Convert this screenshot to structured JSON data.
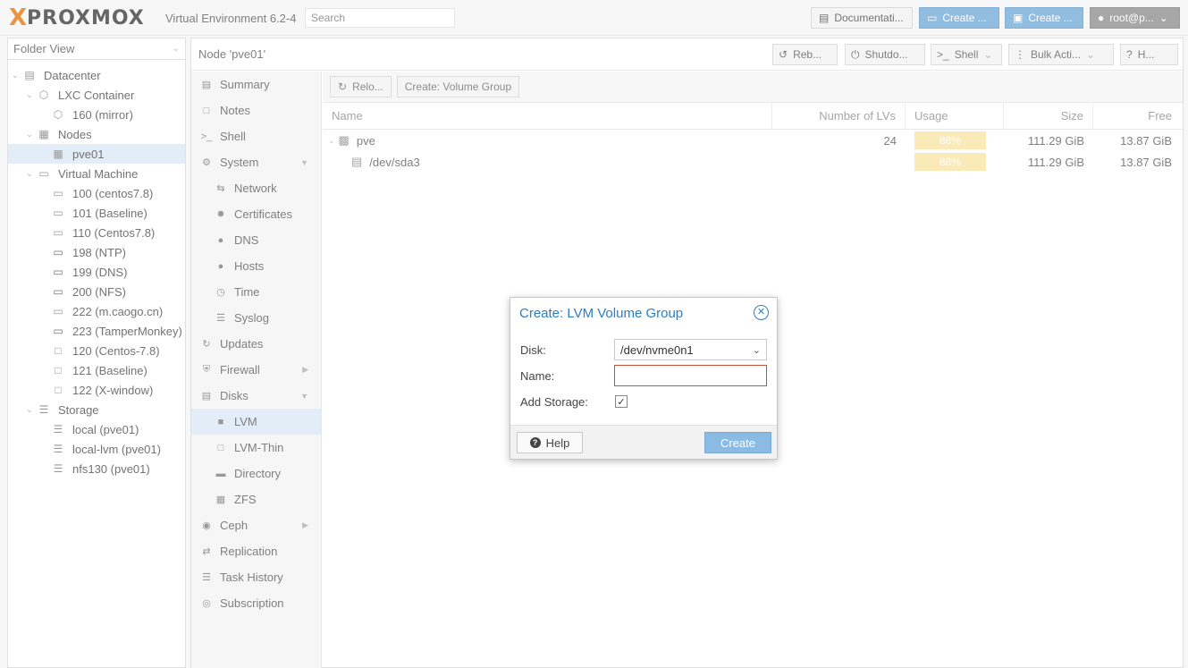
{
  "header": {
    "logo_x": "X",
    "logo_word": "PROXMOX",
    "version": "Virtual Environment 6.2-4",
    "search_placeholder": "Search",
    "docs_label": "Documentati...",
    "create_vm_label": "Create ...",
    "create_ct_label": "Create ...",
    "user_label": "root@p..."
  },
  "left": {
    "view": "Folder View",
    "tree": [
      {
        "label": "Datacenter",
        "icon": "datacenter-icon"
      },
      {
        "label": "LXC Container",
        "icon": "cube-icon"
      },
      {
        "label": "160 (mirror)",
        "icon": "container-icon"
      },
      {
        "label": "Nodes",
        "icon": "building-icon"
      },
      {
        "label": "pve01",
        "icon": "node-icon"
      },
      {
        "label": "Virtual Machine",
        "icon": "monitor-icon"
      },
      {
        "label": "100 (centos7.8)",
        "icon": "vm-stopped-icon"
      },
      {
        "label": "101 (Baseline)",
        "icon": "vm-stopped-icon"
      },
      {
        "label": "110 (Centos7.8)",
        "icon": "vm-stopped-icon"
      },
      {
        "label": "198 (NTP)",
        "icon": "vm-running-icon"
      },
      {
        "label": "199 (DNS)",
        "icon": "vm-running-icon"
      },
      {
        "label": "200 (NFS)",
        "icon": "vm-running-icon"
      },
      {
        "label": "222 (m.caogo.cn)",
        "icon": "vm-stopped-icon"
      },
      {
        "label": "223 (TamperMonkey)",
        "icon": "vm-running-icon"
      },
      {
        "label": "120 (Centos-7.8)",
        "icon": "template-icon"
      },
      {
        "label": "121 (Baseline)",
        "icon": "template-icon"
      },
      {
        "label": "122 (X-window)",
        "icon": "template-icon"
      },
      {
        "label": "Storage",
        "icon": "database-icon"
      },
      {
        "label": "local (pve01)",
        "icon": "storage-icon"
      },
      {
        "label": "local-lvm (pve01)",
        "icon": "storage-icon"
      },
      {
        "label": "nfs130 (pve01)",
        "icon": "storage-icon"
      }
    ]
  },
  "main": {
    "title": "Node 'pve01'",
    "buttons": {
      "reboot": "Reb...",
      "shutdown": "Shutdo...",
      "shell": "Shell",
      "bulk": "Bulk Acti...",
      "help": "H..."
    },
    "nav": [
      {
        "label": "Summary",
        "icon": "book-icon"
      },
      {
        "label": "Notes",
        "icon": "note-icon"
      },
      {
        "label": "Shell",
        "icon": "terminal-icon"
      },
      {
        "label": "System",
        "icon": "gears-icon"
      },
      {
        "label": "Network",
        "icon": "exchange-icon"
      },
      {
        "label": "Certificates",
        "icon": "certificate-icon"
      },
      {
        "label": "DNS",
        "icon": "globe-icon"
      },
      {
        "label": "Hosts",
        "icon": "globe-icon"
      },
      {
        "label": "Time",
        "icon": "clock-icon"
      },
      {
        "label": "Syslog",
        "icon": "list-icon"
      },
      {
        "label": "Updates",
        "icon": "refresh-icon"
      },
      {
        "label": "Firewall",
        "icon": "shield-icon"
      },
      {
        "label": "Disks",
        "icon": "hdd-icon"
      },
      {
        "label": "LVM",
        "icon": "square-icon"
      },
      {
        "label": "LVM-Thin",
        "icon": "square-outline-icon"
      },
      {
        "label": "Directory",
        "icon": "folder-icon"
      },
      {
        "label": "ZFS",
        "icon": "th-large-icon"
      },
      {
        "label": "Ceph",
        "icon": "ceph-icon"
      },
      {
        "label": "Replication",
        "icon": "retweet-icon"
      },
      {
        "label": "Task History",
        "icon": "list-alt-icon"
      },
      {
        "label": "Subscription",
        "icon": "support-icon"
      }
    ],
    "toolbar": {
      "reload": "Relo...",
      "create_vg": "Create: Volume Group"
    },
    "grid": {
      "columns": [
        "Name",
        "Number of LVs",
        "Usage",
        "Size",
        "Free"
      ],
      "rows": [
        {
          "name": "pve",
          "lvs": "24",
          "usage": "88%",
          "size": "111.29 GiB",
          "free": "13.87 GiB"
        },
        {
          "name": "/dev/sda3",
          "lvs": "",
          "usage": "88%",
          "size": "111.29 GiB",
          "free": "13.87 GiB"
        }
      ]
    }
  },
  "dialog": {
    "title": "Create: LVM Volume Group",
    "disk_label": "Disk:",
    "disk_value": "/dev/nvme0n1",
    "name_label": "Name:",
    "name_value": "",
    "storage_label": "Add Storage:",
    "storage_checked": true,
    "help_label": "Help",
    "create_label": "Create"
  }
}
